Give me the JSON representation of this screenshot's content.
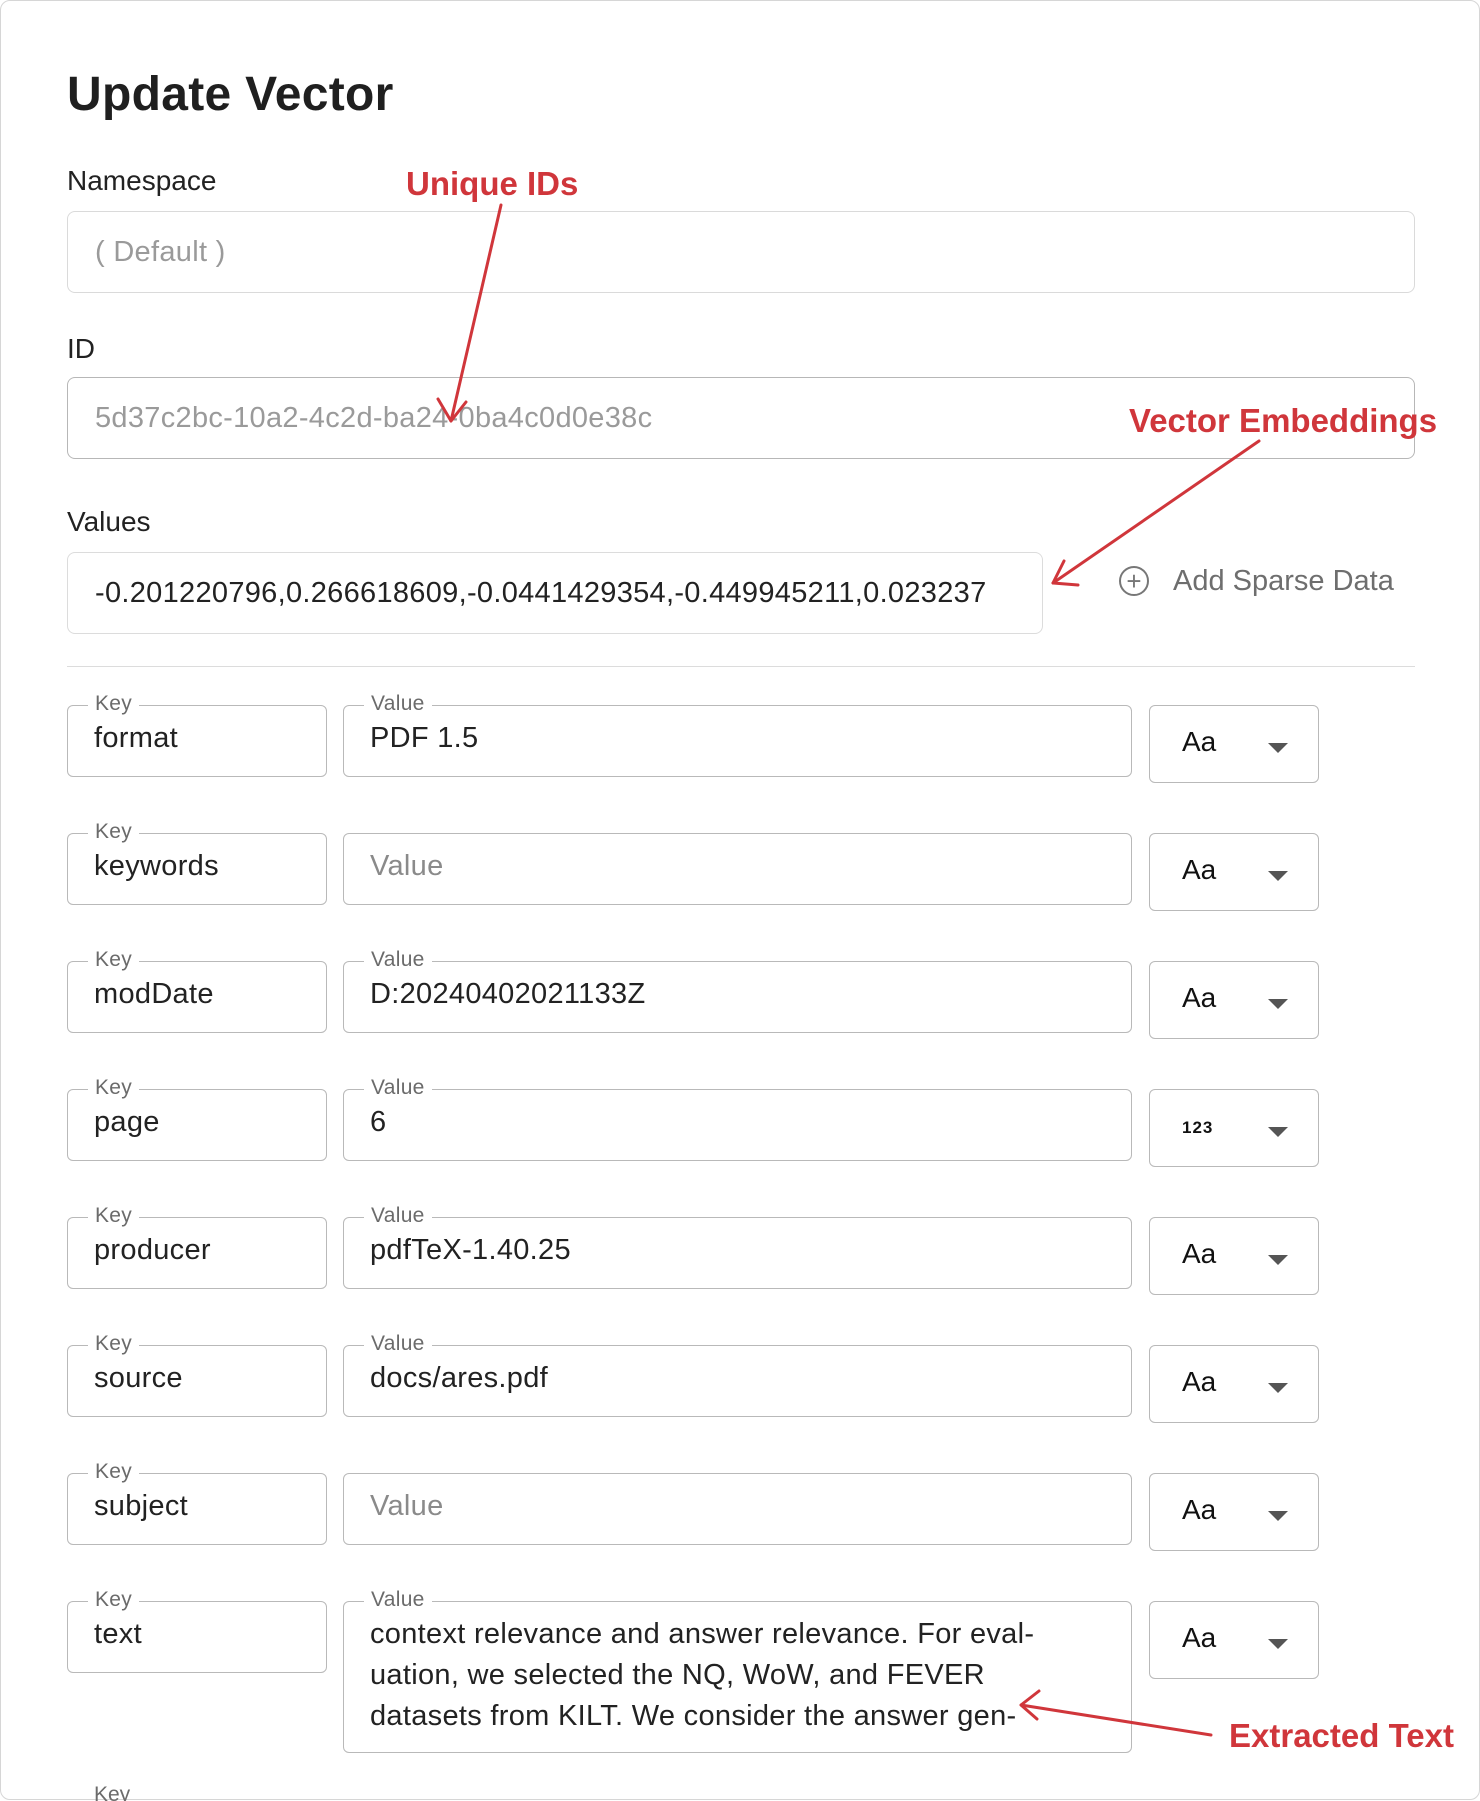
{
  "dialog": {
    "title": "Update Vector",
    "namespace": {
      "label": "Namespace",
      "value": "( Default )"
    },
    "id": {
      "label": "ID",
      "value": "5d37c2bc-10a2-4c2d-ba24-0ba4c0d0e38c"
    },
    "values": {
      "label": "Values",
      "value": "-0.201220796,0.266618609,-0.0441429354,-0.449945211,0.023237"
    },
    "add_sparse_label": "Add Sparse Data",
    "key_legend": "Key",
    "value_legend": "Value",
    "value_placeholder": "Value",
    "metadata": [
      {
        "key": "format",
        "value": "PDF 1.5",
        "type": "Aa"
      },
      {
        "key": "keywords",
        "value": "",
        "type": "Aa"
      },
      {
        "key": "modDate",
        "value": "D:20240402021133Z",
        "type": "Aa"
      },
      {
        "key": "page",
        "value": "6",
        "type": "123"
      },
      {
        "key": "producer",
        "value": "pdfTeX-1.40.25",
        "type": "Aa"
      },
      {
        "key": "source",
        "value": "docs/ares.pdf",
        "type": "Aa"
      },
      {
        "key": "subject",
        "value": "",
        "type": "Aa"
      },
      {
        "key": "text",
        "value": "context relevance and answer relevance. For eval- uation, we selected the NQ, WoW, and FEVER datasets from KILT. We consider the answer gen-",
        "type": "Aa"
      }
    ],
    "next_key_legend": "Key"
  },
  "annotations": {
    "unique_ids": "Unique IDs",
    "vector_embeddings": "Vector Embeddings",
    "extracted_text": "Extracted Text"
  },
  "colors": {
    "annotation": "#d0363b"
  },
  "icons": {
    "add": "plus-circle-icon",
    "dropdown": "caret-down-icon"
  }
}
